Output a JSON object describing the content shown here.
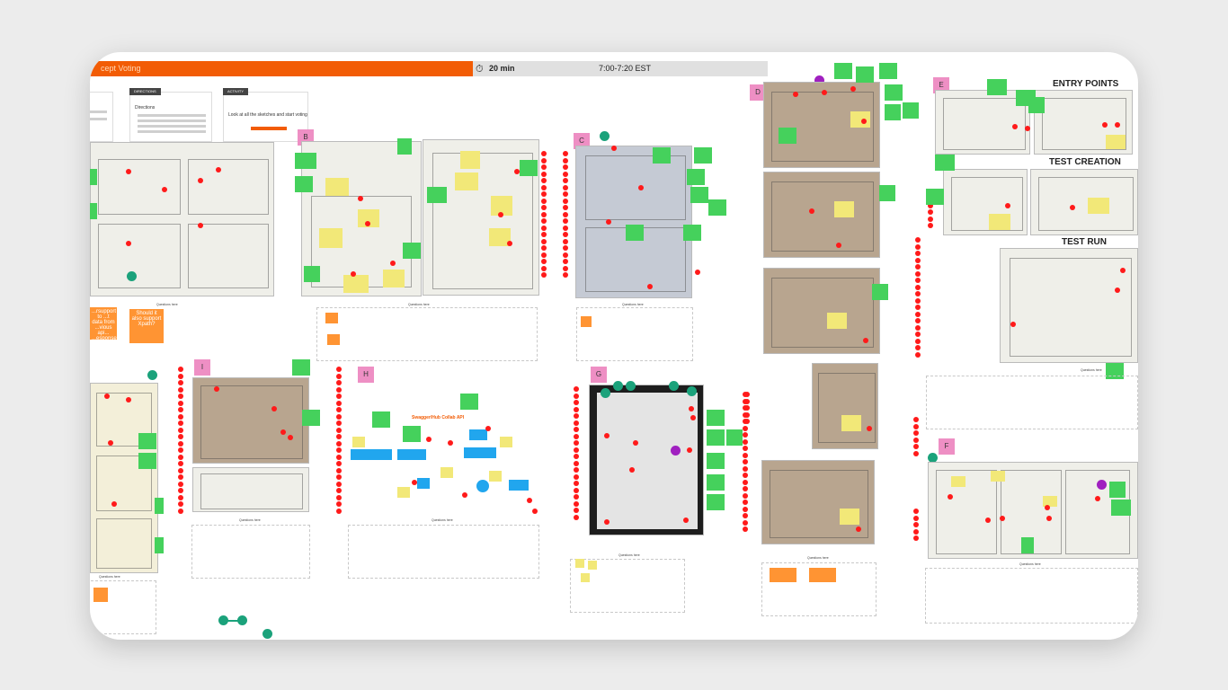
{
  "header": {
    "session_title": "cept Voting",
    "timer_icon": "stopwatch-icon",
    "duration": "20 min",
    "time_range": "7:00-7:20 EST"
  },
  "cards": [
    {
      "tag": "DIRECTIONS",
      "title": "Directions"
    },
    {
      "tag": "ACTIVITY",
      "title": "Look at all the sketches and start voting"
    }
  ],
  "sections": [
    {
      "letter": "B"
    },
    {
      "letter": "C"
    },
    {
      "letter": "D"
    },
    {
      "letter": "E"
    },
    {
      "letter": "I"
    },
    {
      "letter": "H"
    },
    {
      "letter": "G"
    },
    {
      "letter": "F"
    }
  ],
  "headings": {
    "entry_points": "ENTRY POINTS",
    "test_creation": "TEST CREATION",
    "test_run": "TEST RUN"
  },
  "questions_label": "Questions here",
  "questions_label_alt": "Questions here",
  "sticky_notes": {
    "q1": "...rsupport to ...t data from ...vious api... ...esponse?",
    "q2": "Should it also support Xpath?"
  },
  "diagram_title": "Swagger/Hub Collab API",
  "colors": {
    "accent_orange": "#f25c05",
    "sticky_green": "#45d15c",
    "sticky_pink": "#ee8fc4",
    "sticky_orange": "#ff9433",
    "vote_dot": "#ff1a1a",
    "teal_dot": "#1ba27b",
    "purple_dot": "#a020c0"
  }
}
